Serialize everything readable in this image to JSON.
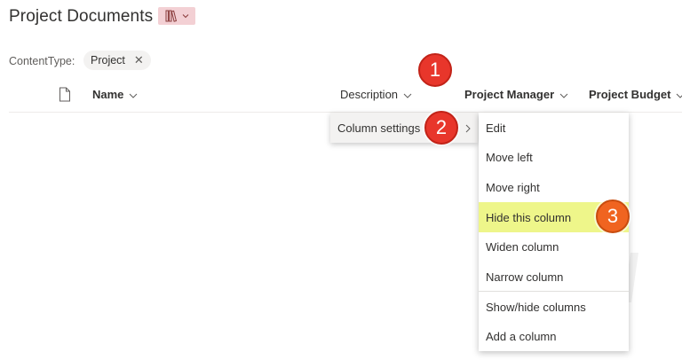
{
  "page": {
    "title": "Project Documents"
  },
  "filter": {
    "label": "ContentType:",
    "value": "Project",
    "remove_glyph": "✕"
  },
  "columns": {
    "name": "Name",
    "description": "Description",
    "project_manager": "Project Manager",
    "project_budget": "Project Budget"
  },
  "context_menu": {
    "item_label": "Column settings"
  },
  "submenu": {
    "items": [
      "Edit",
      "Move left",
      "Move right",
      "Hide this column",
      "Widen column",
      "Narrow column",
      "Show/hide columns",
      "Add a column"
    ]
  },
  "callouts": [
    "1",
    "2",
    "3"
  ],
  "colors": {
    "highlight": "#eef68a",
    "callout_red": "#e8362b",
    "callout_orange": "#f06420",
    "view_switch_bg": "#f3d0d4"
  },
  "icons": {
    "view_switch": "library-icon",
    "file": "document-icon"
  }
}
